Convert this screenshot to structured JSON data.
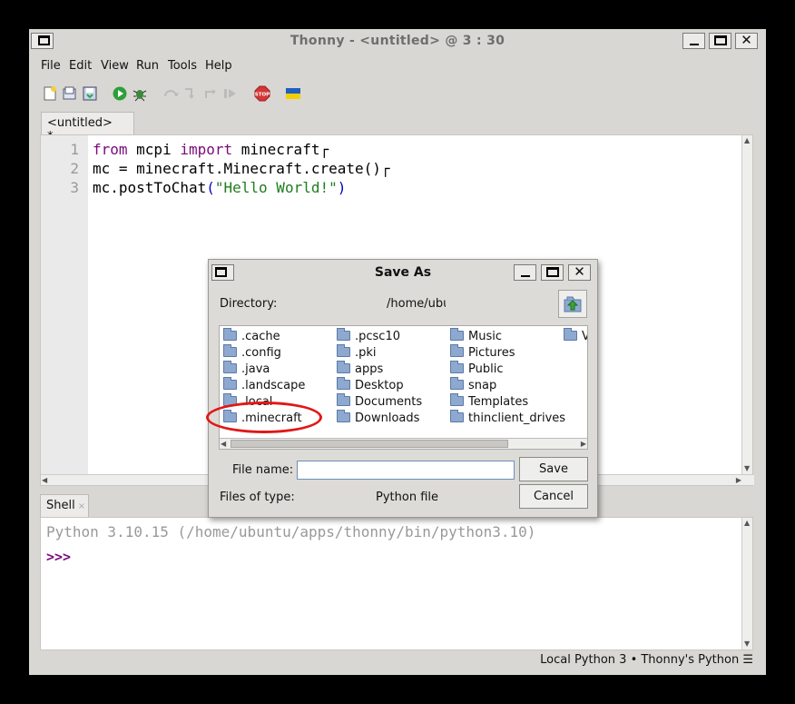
{
  "window": {
    "title": "Thonny  -  <untitled>  @  3 : 30"
  },
  "menu": [
    "File",
    "Edit",
    "View",
    "Run",
    "Tools",
    "Help"
  ],
  "toolbar": {
    "icons": [
      "new-file-icon",
      "open-file-icon",
      "save-file-icon",
      "run-icon",
      "debug-icon",
      "step-over-icon",
      "step-into-icon",
      "step-out-icon",
      "resume-icon",
      "stop-icon",
      "flag-icon"
    ],
    "stop_label": "STOP"
  },
  "editor": {
    "tab_label": "<untitled> *",
    "tab_close": "×",
    "line_numbers": [
      "1",
      "2",
      "3"
    ],
    "lines": [
      {
        "kw1": "from",
        "t1": " mcpi ",
        "kw2": "import",
        "t2": " minecraft",
        "eol": "┌"
      },
      {
        "t1": "mc = minecraft.Minecraft.create()",
        "eol": "┌"
      },
      {
        "t1": "mc.postToChat",
        "p1": "(",
        "s": "\"Hello World!\"",
        "p2": ")"
      }
    ]
  },
  "shell": {
    "tab_label": "Shell",
    "tab_close": "×",
    "banner": "Python 3.10.15 (/home/ubuntu/apps/thonny/bin/python3.10)",
    "prompt": ">>>"
  },
  "status": {
    "text": "Local Python 3  •  Thonny's Python  ☰"
  },
  "dialog": {
    "title": "Save As",
    "directory_label": "Directory:",
    "directory_value": "/home/ubu",
    "columns": [
      [
        ".cache",
        ".config",
        ".java",
        ".landscape",
        ".local",
        ".minecraft"
      ],
      [
        ".pcsc10",
        ".pki",
        "apps",
        "Desktop",
        "Documents",
        "Downloads"
      ],
      [
        "Music",
        "Pictures",
        "Public",
        "snap",
        "Templates",
        "thinclient_drives"
      ],
      [
        "V"
      ]
    ],
    "filename_label": "File name:",
    "filename_value": "",
    "filetype_label": "Files of type:",
    "filetype_value": "Python file",
    "save_label": "Save",
    "cancel_label": "Cancel"
  },
  "colors": {
    "highlight_ellipse": "#e01818",
    "keyword": "#7a0a7a",
    "string": "#1f7d1f"
  }
}
